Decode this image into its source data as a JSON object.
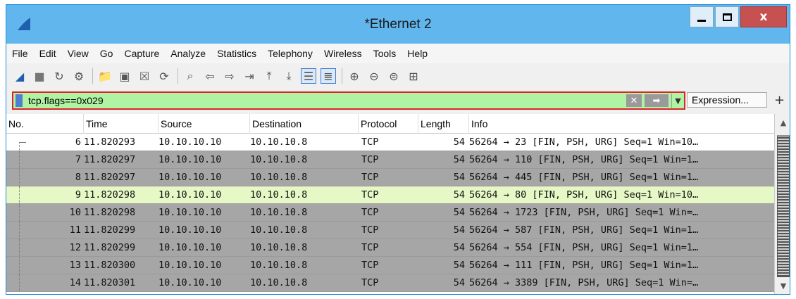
{
  "window": {
    "title": "*Ethernet 2",
    "close_label": "x"
  },
  "menu": [
    "File",
    "Edit",
    "View",
    "Go",
    "Capture",
    "Analyze",
    "Statistics",
    "Telephony",
    "Wireless",
    "Tools",
    "Help"
  ],
  "toolbar": {
    "icons": [
      "shark-fin-start-icon",
      "stop-icon",
      "restart-icon",
      "options-icon",
      "open-file-icon",
      "save-file-icon",
      "close-file-icon",
      "reload-icon",
      "find-icon",
      "go-back-icon",
      "go-forward-icon",
      "go-to-packet-icon",
      "go-first-icon",
      "go-last-icon",
      "autoscroll-icon",
      "colorize-icon",
      "zoom-in-icon",
      "zoom-out-icon",
      "zoom-normal-icon",
      "resize-columns-icon"
    ]
  },
  "filter": {
    "value": "tcp.flags==0x029",
    "expression_label": "Expression...",
    "add_label": "+"
  },
  "packet_list": {
    "columns": [
      "No.",
      "Time",
      "Source",
      "Destination",
      "Protocol",
      "Length",
      "Info"
    ],
    "rows": [
      {
        "no": "6",
        "time": "11.820293",
        "src": "10.10.10.10",
        "dst": "10.10.10.8",
        "proto": "TCP",
        "len": "54",
        "info": "56264 → 23 [FIN, PSH, URG] Seq=1 Win=10…"
      },
      {
        "no": "7",
        "time": "11.820297",
        "src": "10.10.10.10",
        "dst": "10.10.10.8",
        "proto": "TCP",
        "len": "54",
        "info": "56264 → 110 [FIN, PSH, URG] Seq=1 Win=1…"
      },
      {
        "no": "8",
        "time": "11.820297",
        "src": "10.10.10.10",
        "dst": "10.10.10.8",
        "proto": "TCP",
        "len": "54",
        "info": "56264 → 445 [FIN, PSH, URG] Seq=1 Win=1…"
      },
      {
        "no": "9",
        "time": "11.820298",
        "src": "10.10.10.10",
        "dst": "10.10.10.8",
        "proto": "TCP",
        "len": "54",
        "info": "56264 → 80 [FIN, PSH, URG] Seq=1 Win=10…"
      },
      {
        "no": "10",
        "time": "11.820298",
        "src": "10.10.10.10",
        "dst": "10.10.10.8",
        "proto": "TCP",
        "len": "54",
        "info": "56264 → 1723 [FIN, PSH, URG] Seq=1 Win=…"
      },
      {
        "no": "11",
        "time": "11.820299",
        "src": "10.10.10.10",
        "dst": "10.10.10.8",
        "proto": "TCP",
        "len": "54",
        "info": "56264 → 587 [FIN, PSH, URG] Seq=1 Win=1…"
      },
      {
        "no": "12",
        "time": "11.820299",
        "src": "10.10.10.10",
        "dst": "10.10.10.8",
        "proto": "TCP",
        "len": "54",
        "info": "56264 → 554 [FIN, PSH, URG] Seq=1 Win=1…"
      },
      {
        "no": "13",
        "time": "11.820300",
        "src": "10.10.10.10",
        "dst": "10.10.10.8",
        "proto": "TCP",
        "len": "54",
        "info": "56264 → 111 [FIN, PSH, URG] Seq=1 Win=1…"
      },
      {
        "no": "14",
        "time": "11.820301",
        "src": "10.10.10.10",
        "dst": "10.10.10.8",
        "proto": "TCP",
        "len": "54",
        "info": "56264 → 3389 [FIN, PSH, URG] Seq=1 Win=…"
      }
    ],
    "selected_index": 3
  },
  "colors": {
    "titlebar": "#62b6ee",
    "filter_valid": "#aff3a3",
    "filter_border": "#d9262b",
    "row_bg": "#a6a6a6",
    "row_selected": "#e5f8c5"
  }
}
